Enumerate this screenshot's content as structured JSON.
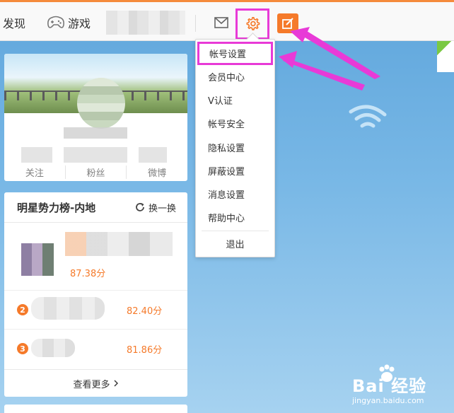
{
  "topbar": {
    "discover": "发现",
    "games": "游戏",
    "accent_color": "#f58b3c",
    "icons": [
      "game-controller-icon",
      "mail-icon",
      "gear-icon",
      "compose-icon"
    ]
  },
  "profile": {
    "stats": [
      "关注",
      "粉丝",
      "微博"
    ]
  },
  "ranking": {
    "title": "明星势力榜-内地",
    "refresh_label": "换一换",
    "rows": [
      {
        "rank": "",
        "score": "87.38分"
      },
      {
        "rank": "2",
        "score": "82.40分"
      },
      {
        "rank": "3",
        "score": "81.86分"
      }
    ],
    "more_label": "查看更多",
    "score_color": "#f57a2a"
  },
  "settings_menu": {
    "items": [
      "帐号设置",
      "会员中心",
      "V认证",
      "帐号安全",
      "隐私设置",
      "屏蔽设置",
      "消息设置",
      "帮助中心"
    ],
    "logout": "退出",
    "highlight_color": "#e83ad7"
  },
  "watermark": {
    "main": "Bai 经验",
    "sub": "jingyan.baidu.com"
  }
}
